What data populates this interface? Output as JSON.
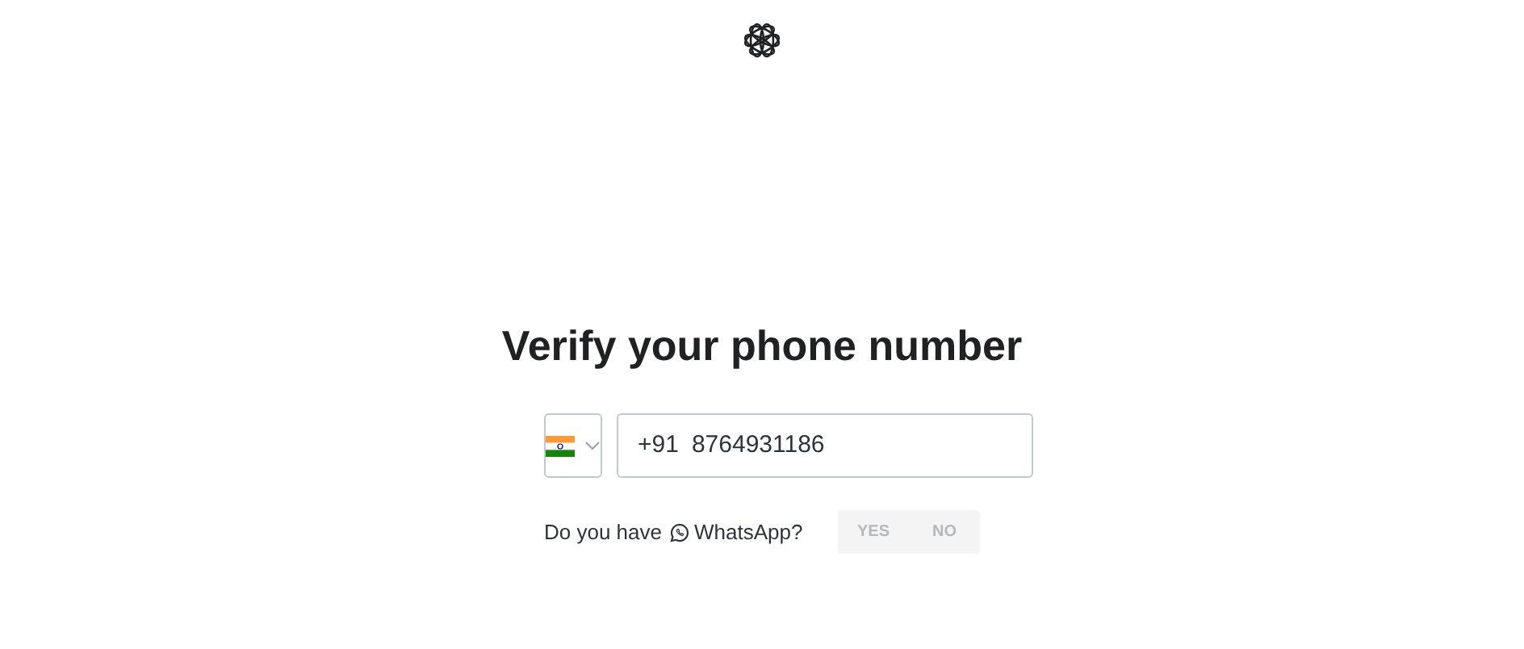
{
  "title": "Verify your phone number",
  "phone": {
    "prefix": "+91",
    "value": "8764931186"
  },
  "whatsapp": {
    "question_before": "Do you have",
    "question_after": "WhatsApp?",
    "options": [
      {
        "label": "YES",
        "selected": false
      },
      {
        "label": "NO",
        "selected": false
      }
    ]
  }
}
